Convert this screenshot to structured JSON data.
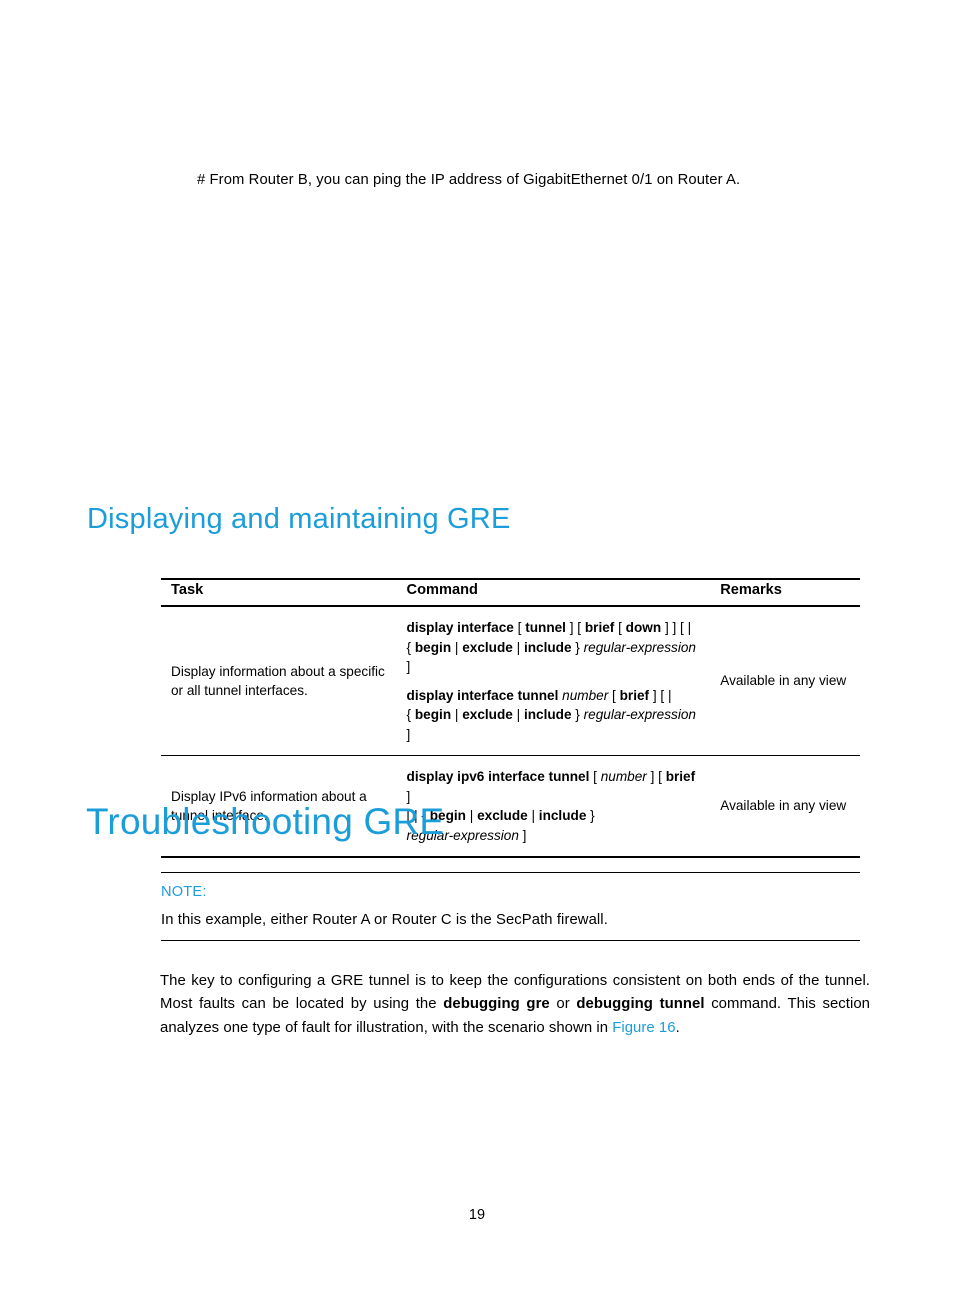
{
  "document": {
    "page_number": "19",
    "accent_color": "#1B9DD9",
    "rule_color": "#000000"
  },
  "intro": {
    "text": "# From Router B, you can ping the IP address of GigabitEthernet 0/1 on Router A."
  },
  "sections": {
    "displaying": {
      "heading": "Displaying and maintaining GRE"
    },
    "troubleshooting": {
      "heading": "Troubleshooting GRE"
    }
  },
  "table": {
    "headers": {
      "task": "Task",
      "command": "Command",
      "remarks": "Remarks"
    },
    "rows": [
      {
        "task": "Display information about a specific or all tunnel interfaces.",
        "commands": [
          {
            "line1_bold": "display interface",
            "line1_rest": " [ ",
            "line1_b2": "tunnel",
            "line1_rest2": " ] [ ",
            "line1_b3": "brief",
            "line1_rest3": " [ ",
            "line1_b4": "down",
            "line1_rest4": " ] ] [ |",
            "line2_pre": "{ ",
            "line2_b1": "begin",
            "line2_s1": " | ",
            "line2_b2": "exclude",
            "line2_s2": " | ",
            "line2_b3": "include",
            "line2_s3": " } ",
            "line2_italic": "regular-expression",
            "line2_end": " ]",
            "plain": "display interface [ tunnel ] [ brief [ down ] ] [ | { begin | exclude | include } regular-expression ]"
          },
          {
            "line1_bold": "display interface tunnel",
            "line1_italic": "number",
            "line1_mid": " [ ",
            "line1_b2": "brief",
            "line1_rest": " ] [ |",
            "line2_pre": "{ ",
            "line2_b1": "begin",
            "line2_s1": " | ",
            "line2_b2": "exclude",
            "line2_s2": " | ",
            "line2_b3": "include",
            "line2_s3": " } ",
            "line2_italic": "regular-expression",
            "line2_end": " ]",
            "plain": "display interface tunnel number [ brief ] [ | { begin | exclude | include } regular-expression ]"
          }
        ],
        "remarks": "Available in any view"
      },
      {
        "task": "Display IPv6 information about a tunnel interface.",
        "commands": [
          {
            "line1_bold": "display ipv6 interface tunnel",
            "line1_pre": " [ ",
            "line1_italic": "number",
            "line1_mid": " ] [ ",
            "line1_b2": "brief",
            "line1_rest": " ]",
            "line2_pre": "[ | { ",
            "line2_b1": "begin",
            "line2_s1": " | ",
            "line2_b2": "exclude",
            "line2_s2": " | ",
            "line2_b3": "include",
            "line2_s3": " }",
            "line3_italic": "regular-expression",
            "line3_end": " ]",
            "plain": "display ipv6 interface tunnel [ number ] [ brief ] [ | { begin | exclude | include } regular-expression ]"
          }
        ],
        "remarks": "Available in any view"
      }
    ]
  },
  "note": {
    "label": "NOTE:",
    "text": "In this example, either Router A or Router C is the SecPath firewall."
  },
  "paragraph": {
    "part1": "The key to configuring a GRE tunnel is to keep the configurations consistent on both ends of the tunnel. Most faults can be located by using the ",
    "bold1": "debugging gre",
    "part2": " or ",
    "bold2": "debugging tunnel",
    "part3": " command. This section analyzes one type of fault for illustration, with the scenario shown in ",
    "link": "Figure 16",
    "part4": "."
  }
}
